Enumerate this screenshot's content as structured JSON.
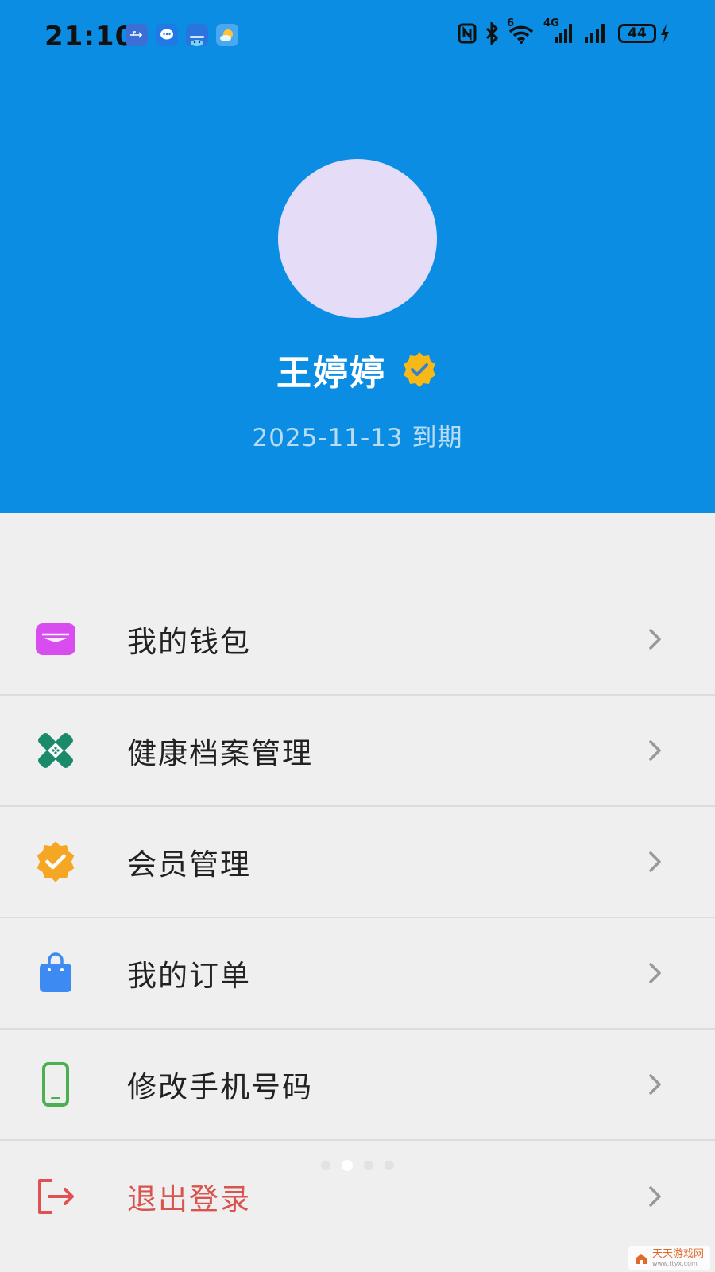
{
  "status_bar": {
    "time": "21:10",
    "network_label": "4G",
    "wifi_badge": "6",
    "battery_level": "44"
  },
  "profile": {
    "name": "王婷婷",
    "expiry": "2025-11-13 到期"
  },
  "menu": {
    "items": [
      {
        "label": "我的钱包",
        "icon": "wallet-icon",
        "color": "#d94cf0"
      },
      {
        "label": "健康档案管理",
        "icon": "bandage-icon",
        "color": "#1a8a6a"
      },
      {
        "label": "会员管理",
        "icon": "verified-badge-icon",
        "color": "#f5a623"
      },
      {
        "label": "我的订单",
        "icon": "shopping-bag-icon",
        "color": "#3d8bf2"
      },
      {
        "label": "修改手机号码",
        "icon": "phone-icon",
        "color": "#4caf50"
      },
      {
        "label": "退出登录",
        "icon": "logout-icon",
        "color": "#e05252"
      }
    ]
  },
  "watermark": {
    "text": "天天游戏网",
    "sub": "www.ttyx.com"
  },
  "colors": {
    "header_bg": "#0a8de2",
    "avatar_bg": "#e5dcf7",
    "danger": "#d9534f"
  }
}
